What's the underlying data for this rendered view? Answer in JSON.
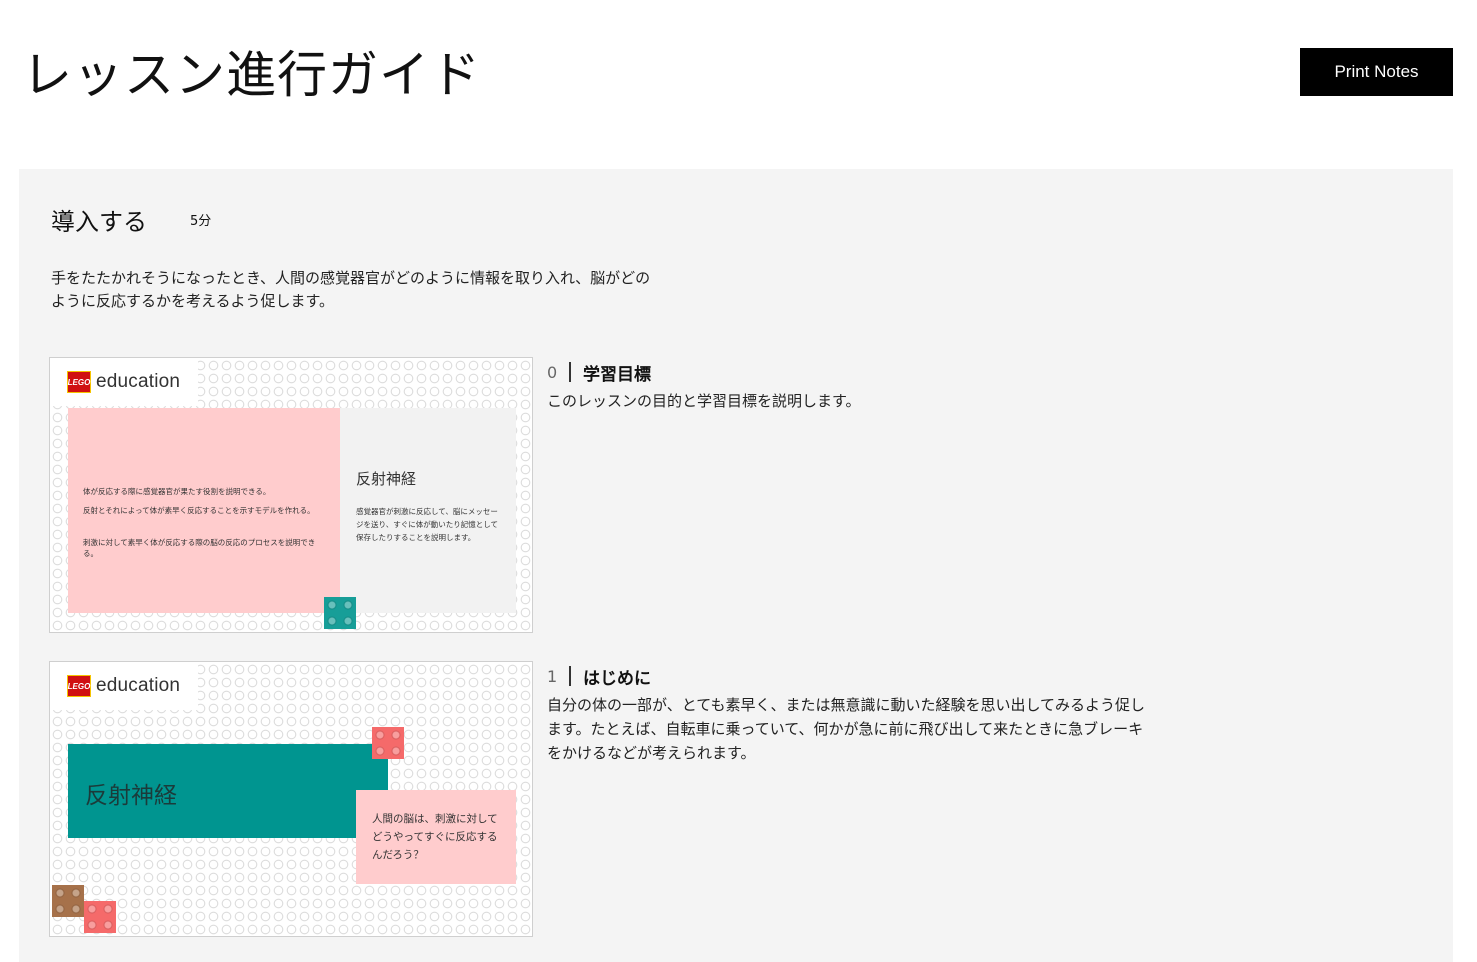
{
  "header": {
    "title": "レッスン進行ガイド",
    "print_label": "Print Notes"
  },
  "section": {
    "title": "導入する",
    "duration": "5分",
    "description": "手をたたかれそうになったとき、人間の感覚器官がどのように情報を取り入れ、脳がどのように反応するかを考えるよう促します。"
  },
  "slides": [
    {
      "logo_box": "LEGO",
      "logo_text": "education",
      "objectives": [
        "体が反応する際に感覚器官が果たす役割を説明できる。",
        "反射とそれによって体が素早く反応することを示すモデルを作れる。",
        "刺激に対して素早く体が反応する際の脳の反応のプロセスを説明できる。"
      ],
      "panel_title": "反射神経",
      "panel_text": "感覚器官が刺激に反応して、脳にメッセージを送り、すぐに体が動いたり記憶として保存したりすることを説明します。",
      "colors": {
        "pink": "#ffcccd",
        "teal_brick": "#179e98"
      }
    },
    {
      "logo_box": "LEGO",
      "logo_text": "education",
      "panel_title": "反射神経",
      "panel_text": "人間の脳は、刺激に対してどうやってすぐに反応するんだろう？",
      "colors": {
        "teal": "#009590",
        "pink": "#ffcccd",
        "coral_brick": "#f56a6a",
        "brown_brick": "#a6714a"
      }
    }
  ],
  "notes": [
    {
      "number": "0",
      "title": "学習目標",
      "text": "このレッスンの目的と学習目標を説明します。"
    },
    {
      "number": "1",
      "title": "はじめに",
      "text": "自分の体の一部が、とても素早く、または無意識に動いた経験を思い出してみるよう促します。たとえば、自転車に乗っていて、何かが急に前に飛び出して来たときに急ブレーキをかけるなどが考えられます。"
    }
  ]
}
